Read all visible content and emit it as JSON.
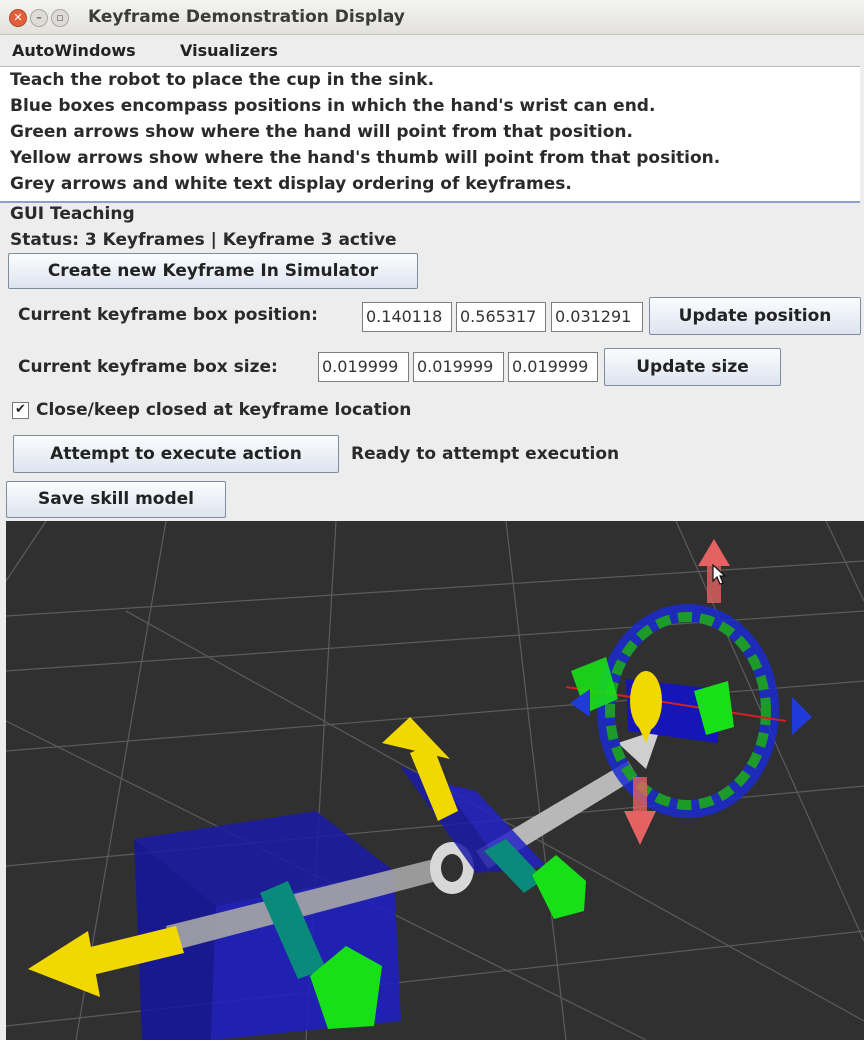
{
  "window": {
    "title": "Keyframe Demonstration Display",
    "close_glyph": "✕",
    "min_glyph": "–",
    "max_glyph": "▫"
  },
  "menubar": {
    "items": [
      "AutoWindows",
      "Visualizers"
    ]
  },
  "instructions": [
    "Teach the robot to place the cup in the sink.",
    "Blue boxes encompass positions in which the hand's wrist can end.",
    "Green arrows show where the hand will point from that position.",
    "Yellow arrows show where the hand's thumb will point from that position.",
    "Grey arrows and white text display ordering of keyframes."
  ],
  "teaching": {
    "heading": "GUI Teaching",
    "status": "Status: 3 Keyframes | Keyframe 3 active",
    "create_button": "Create new Keyframe In Simulator",
    "position_label": "Current keyframe box position:",
    "position_values": [
      "0.140118",
      "0.565317",
      "0.031291"
    ],
    "update_position_button": "Update position",
    "size_label": "Current keyframe box size:",
    "size_values": [
      "0.019999",
      "0.019999",
      "0.019999"
    ],
    "update_size_button": "Update size",
    "close_checkbox_checked": true,
    "close_checkbox_glyph": "✔",
    "close_checkbox_label": "Close/keep closed at keyframe location",
    "execute_button": "Attempt to execute action",
    "execute_status": "Ready to attempt execution",
    "save_button": "Save skill model"
  },
  "colors": {
    "viewport_bg": "#303030",
    "grid": "#5a5a5a",
    "keyframe_box": "#1a1aa8",
    "pointing_arrow": "#18e018",
    "thumb_arrow": "#f0d800",
    "order_arrow": "#9a9a9a",
    "marker_red": "#e46262"
  }
}
